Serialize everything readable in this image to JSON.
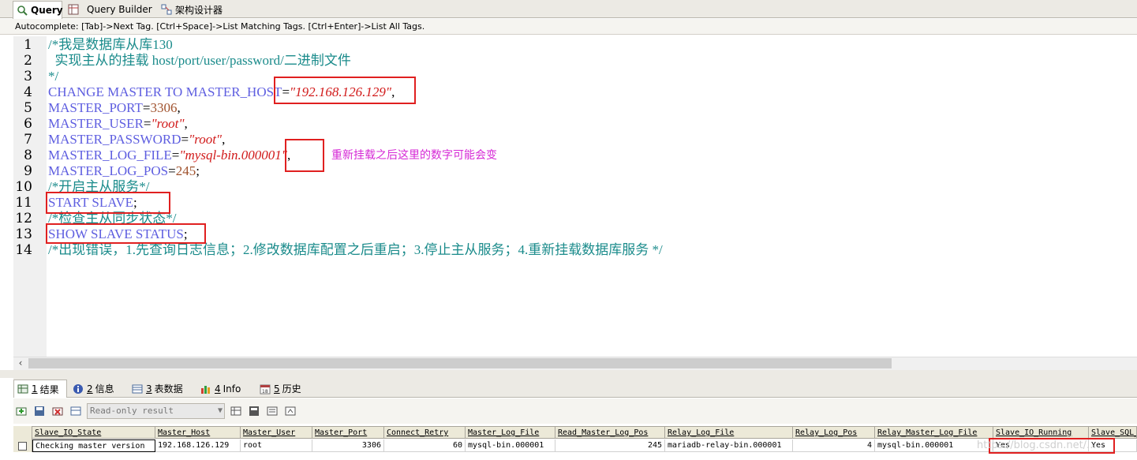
{
  "tabs": [
    {
      "label": "Query",
      "icon": "query-icon"
    },
    {
      "label": "Query Builder",
      "icon": "query-builder-icon"
    },
    {
      "label": "架构设计器",
      "icon": "schema-designer-icon"
    }
  ],
  "autocomplete": "Autocomplete: [Tab]->Next Tag. [Ctrl+Space]->List Matching Tags. [Ctrl+Enter]->List All Tags.",
  "editor": {
    "line_numbers": [
      "1",
      "2",
      "3",
      "4",
      "5",
      "6",
      "7",
      "8",
      "9",
      "10",
      "11",
      "12",
      "13",
      "14"
    ],
    "lines": [
      [
        {
          "t": "/*我是数据库从库130",
          "c": "cm"
        }
      ],
      [
        {
          "t": "  实现主从的挂载 host/port/user/password/二进制文件",
          "c": "cm"
        }
      ],
      [
        {
          "t": "*/",
          "c": "cm"
        }
      ],
      [
        {
          "t": "CHANGE MASTER TO MASTER_HOST",
          "c": "kw"
        },
        {
          "t": "=",
          "c": "op"
        },
        {
          "t": "\"192.168.126.129\"",
          "c": "st"
        },
        {
          "t": ",",
          "c": "op"
        }
      ],
      [
        {
          "t": "MASTER_PORT",
          "c": "kw"
        },
        {
          "t": "=",
          "c": "op"
        },
        {
          "t": "3306",
          "c": "nm"
        },
        {
          "t": ",",
          "c": "op"
        }
      ],
      [
        {
          "t": "MASTER_USER",
          "c": "kw"
        },
        {
          "t": "=",
          "c": "op"
        },
        {
          "t": "\"root\"",
          "c": "st"
        },
        {
          "t": ",",
          "c": "op"
        }
      ],
      [
        {
          "t": "MASTER_PASSWORD",
          "c": "kw"
        },
        {
          "t": "=",
          "c": "op"
        },
        {
          "t": "\"root\"",
          "c": "st"
        },
        {
          "t": ",",
          "c": "op"
        }
      ],
      [
        {
          "t": "MASTER_LOG_FILE",
          "c": "kw"
        },
        {
          "t": "=",
          "c": "op"
        },
        {
          "t": "\"mysql-bin.000001\"",
          "c": "st"
        },
        {
          "t": ",",
          "c": "op"
        }
      ],
      [
        {
          "t": "MASTER_LOG_POS",
          "c": "kw"
        },
        {
          "t": "=",
          "c": "op"
        },
        {
          "t": "245",
          "c": "nm"
        },
        {
          "t": ";",
          "c": "op"
        }
      ],
      [
        {
          "t": "/*开启主从服务*/",
          "c": "cm"
        }
      ],
      [
        {
          "t": "START SLAVE",
          "c": "kw"
        },
        {
          "t": ";",
          "c": "op"
        }
      ],
      [
        {
          "t": "/*检查主从同步状态*/",
          "c": "cm"
        }
      ],
      [
        {
          "t": "SHOW SLAVE STATUS",
          "c": "kw"
        },
        {
          "t": ";",
          "c": "op"
        }
      ],
      [
        {
          "t": "/*出现错误，1.先查询日志信息；2.修改数据库配置之后重启；3.停止主从服务；4.重新挂载数据库服务 */",
          "c": "cm"
        }
      ]
    ],
    "annotation": "重新挂载之后这里的数字可能会变"
  },
  "result_tabs": [
    {
      "num": "1",
      "label": "结果",
      "icon": "result-grid-icon"
    },
    {
      "num": "2",
      "label": "信息",
      "icon": "info-circle-icon"
    },
    {
      "num": "3",
      "label": "表数据",
      "icon": "table-data-icon"
    },
    {
      "num": "4",
      "label": "Info",
      "icon": "info-bars-icon"
    },
    {
      "num": "5",
      "label": "历史",
      "icon": "history-calendar-icon"
    }
  ],
  "toolbar": {
    "readonly_label": "Read-only result"
  },
  "grid": {
    "columns": [
      "Slave_IO_State",
      "Master_Host",
      "Master_User",
      "Master_Port",
      "Connect_Retry",
      "Master_Log_File",
      "Read_Master_Log_Pos",
      "Relay_Log_File",
      "Relay_Log_Pos",
      "Relay_Master_Log_File",
      "Slave_IO_Running",
      "Slave_SQL_"
    ],
    "row": [
      "Checking master version",
      "192.168.126.129",
      "root",
      "3306",
      "60",
      "mysql-bin.000001",
      "245",
      "mariadb-relay-bin.000001",
      "4",
      "mysql-bin.000001",
      "Yes",
      "Yes"
    ]
  },
  "watermark": "https://blog.csdn.net/..."
}
